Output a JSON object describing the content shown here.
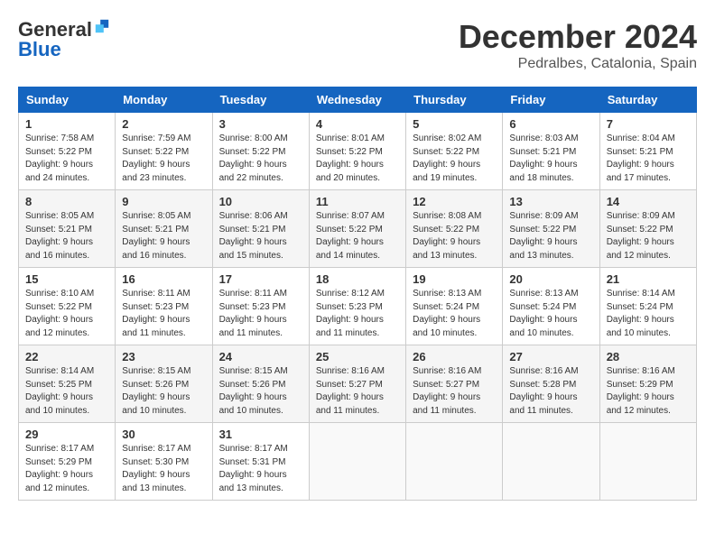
{
  "header": {
    "logo_general": "General",
    "logo_blue": "Blue",
    "month_title": "December 2024",
    "location": "Pedralbes, Catalonia, Spain"
  },
  "weekdays": [
    "Sunday",
    "Monday",
    "Tuesday",
    "Wednesday",
    "Thursday",
    "Friday",
    "Saturday"
  ],
  "weeks": [
    [
      {
        "day": "1",
        "sunrise": "Sunrise: 7:58 AM",
        "sunset": "Sunset: 5:22 PM",
        "daylight": "Daylight: 9 hours and 24 minutes."
      },
      {
        "day": "2",
        "sunrise": "Sunrise: 7:59 AM",
        "sunset": "Sunset: 5:22 PM",
        "daylight": "Daylight: 9 hours and 23 minutes."
      },
      {
        "day": "3",
        "sunrise": "Sunrise: 8:00 AM",
        "sunset": "Sunset: 5:22 PM",
        "daylight": "Daylight: 9 hours and 22 minutes."
      },
      {
        "day": "4",
        "sunrise": "Sunrise: 8:01 AM",
        "sunset": "Sunset: 5:22 PM",
        "daylight": "Daylight: 9 hours and 20 minutes."
      },
      {
        "day": "5",
        "sunrise": "Sunrise: 8:02 AM",
        "sunset": "Sunset: 5:22 PM",
        "daylight": "Daylight: 9 hours and 19 minutes."
      },
      {
        "day": "6",
        "sunrise": "Sunrise: 8:03 AM",
        "sunset": "Sunset: 5:21 PM",
        "daylight": "Daylight: 9 hours and 18 minutes."
      },
      {
        "day": "7",
        "sunrise": "Sunrise: 8:04 AM",
        "sunset": "Sunset: 5:21 PM",
        "daylight": "Daylight: 9 hours and 17 minutes."
      }
    ],
    [
      {
        "day": "8",
        "sunrise": "Sunrise: 8:05 AM",
        "sunset": "Sunset: 5:21 PM",
        "daylight": "Daylight: 9 hours and 16 minutes."
      },
      {
        "day": "9",
        "sunrise": "Sunrise: 8:05 AM",
        "sunset": "Sunset: 5:21 PM",
        "daylight": "Daylight: 9 hours and 16 minutes."
      },
      {
        "day": "10",
        "sunrise": "Sunrise: 8:06 AM",
        "sunset": "Sunset: 5:21 PM",
        "daylight": "Daylight: 9 hours and 15 minutes."
      },
      {
        "day": "11",
        "sunrise": "Sunrise: 8:07 AM",
        "sunset": "Sunset: 5:22 PM",
        "daylight": "Daylight: 9 hours and 14 minutes."
      },
      {
        "day": "12",
        "sunrise": "Sunrise: 8:08 AM",
        "sunset": "Sunset: 5:22 PM",
        "daylight": "Daylight: 9 hours and 13 minutes."
      },
      {
        "day": "13",
        "sunrise": "Sunrise: 8:09 AM",
        "sunset": "Sunset: 5:22 PM",
        "daylight": "Daylight: 9 hours and 13 minutes."
      },
      {
        "day": "14",
        "sunrise": "Sunrise: 8:09 AM",
        "sunset": "Sunset: 5:22 PM",
        "daylight": "Daylight: 9 hours and 12 minutes."
      }
    ],
    [
      {
        "day": "15",
        "sunrise": "Sunrise: 8:10 AM",
        "sunset": "Sunset: 5:22 PM",
        "daylight": "Daylight: 9 hours and 12 minutes."
      },
      {
        "day": "16",
        "sunrise": "Sunrise: 8:11 AM",
        "sunset": "Sunset: 5:23 PM",
        "daylight": "Daylight: 9 hours and 11 minutes."
      },
      {
        "day": "17",
        "sunrise": "Sunrise: 8:11 AM",
        "sunset": "Sunset: 5:23 PM",
        "daylight": "Daylight: 9 hours and 11 minutes."
      },
      {
        "day": "18",
        "sunrise": "Sunrise: 8:12 AM",
        "sunset": "Sunset: 5:23 PM",
        "daylight": "Daylight: 9 hours and 11 minutes."
      },
      {
        "day": "19",
        "sunrise": "Sunrise: 8:13 AM",
        "sunset": "Sunset: 5:24 PM",
        "daylight": "Daylight: 9 hours and 10 minutes."
      },
      {
        "day": "20",
        "sunrise": "Sunrise: 8:13 AM",
        "sunset": "Sunset: 5:24 PM",
        "daylight": "Daylight: 9 hours and 10 minutes."
      },
      {
        "day": "21",
        "sunrise": "Sunrise: 8:14 AM",
        "sunset": "Sunset: 5:24 PM",
        "daylight": "Daylight: 9 hours and 10 minutes."
      }
    ],
    [
      {
        "day": "22",
        "sunrise": "Sunrise: 8:14 AM",
        "sunset": "Sunset: 5:25 PM",
        "daylight": "Daylight: 9 hours and 10 minutes."
      },
      {
        "day": "23",
        "sunrise": "Sunrise: 8:15 AM",
        "sunset": "Sunset: 5:26 PM",
        "daylight": "Daylight: 9 hours and 10 minutes."
      },
      {
        "day": "24",
        "sunrise": "Sunrise: 8:15 AM",
        "sunset": "Sunset: 5:26 PM",
        "daylight": "Daylight: 9 hours and 10 minutes."
      },
      {
        "day": "25",
        "sunrise": "Sunrise: 8:16 AM",
        "sunset": "Sunset: 5:27 PM",
        "daylight": "Daylight: 9 hours and 11 minutes."
      },
      {
        "day": "26",
        "sunrise": "Sunrise: 8:16 AM",
        "sunset": "Sunset: 5:27 PM",
        "daylight": "Daylight: 9 hours and 11 minutes."
      },
      {
        "day": "27",
        "sunrise": "Sunrise: 8:16 AM",
        "sunset": "Sunset: 5:28 PM",
        "daylight": "Daylight: 9 hours and 11 minutes."
      },
      {
        "day": "28",
        "sunrise": "Sunrise: 8:16 AM",
        "sunset": "Sunset: 5:29 PM",
        "daylight": "Daylight: 9 hours and 12 minutes."
      }
    ],
    [
      {
        "day": "29",
        "sunrise": "Sunrise: 8:17 AM",
        "sunset": "Sunset: 5:29 PM",
        "daylight": "Daylight: 9 hours and 12 minutes."
      },
      {
        "day": "30",
        "sunrise": "Sunrise: 8:17 AM",
        "sunset": "Sunset: 5:30 PM",
        "daylight": "Daylight: 9 hours and 13 minutes."
      },
      {
        "day": "31",
        "sunrise": "Sunrise: 8:17 AM",
        "sunset": "Sunset: 5:31 PM",
        "daylight": "Daylight: 9 hours and 13 minutes."
      },
      null,
      null,
      null,
      null
    ]
  ]
}
